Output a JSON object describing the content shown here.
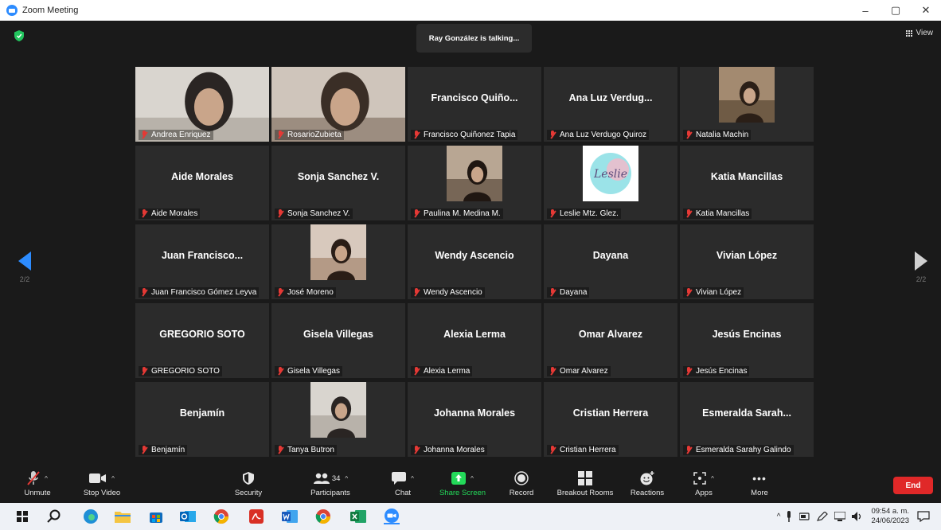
{
  "window": {
    "title": "Zoom Meeting",
    "minimize": "–",
    "maximize": "▢",
    "close": "✕"
  },
  "header": {
    "talking": "Ray González is talking...",
    "view_label": "View"
  },
  "pagination": {
    "left": "2/2",
    "right": "2/2"
  },
  "tiles": [
    {
      "label": "Andrea Enriquez",
      "video": "full"
    },
    {
      "label": "RosarioZubieta",
      "video": "full"
    },
    {
      "big": "Francisco  Quiño...",
      "label": "Francisco Quiñonez Tapia"
    },
    {
      "big": "Ana Luz Verdug...",
      "label": "Ana Luz Verdugo Quiroz"
    },
    {
      "label": "Natalia Machin",
      "video": "thumb"
    },
    {
      "big": "Aide Morales",
      "label": "Aide Morales"
    },
    {
      "big": "Sonja Sanchez V.",
      "label": "Sonja Sanchez V."
    },
    {
      "label": "Paulina M. Medina M.",
      "video": "thumb"
    },
    {
      "label": "Leslie Mtz. Glez.",
      "video": "logo",
      "logo_text": "Leslie"
    },
    {
      "big": "Katia Mancillas",
      "label": "Katia Mancillas"
    },
    {
      "big": "Juan  Francisco...",
      "label": "Juan Francisco Gómez Leyva"
    },
    {
      "label": "José Moreno",
      "video": "thumb"
    },
    {
      "big": "Wendy Ascencio",
      "label": "Wendy Ascencio"
    },
    {
      "big": "Dayana",
      "label": "Dayana"
    },
    {
      "big": "Vivian López",
      "label": "Vivian López"
    },
    {
      "big": "GREGORIO SOTO",
      "label": "GREGORIO SOTO"
    },
    {
      "big": "Gisela Villegas",
      "label": "Gisela Villegas"
    },
    {
      "big": "Alexia Lerma",
      "label": "Alexia Lerma"
    },
    {
      "big": "Omar Alvarez",
      "label": "Omar Alvarez"
    },
    {
      "big": "Jesús Encinas",
      "label": "Jesús Encinas"
    },
    {
      "big": "Benjamín",
      "label": "Benjamín"
    },
    {
      "label": "Tanya Butron",
      "video": "thumb"
    },
    {
      "big": "Johanna Morales",
      "label": "Johanna Morales"
    },
    {
      "big": "Cristian Herrera",
      "label": "Cristian Herrera"
    },
    {
      "big": "Esmeralda  Sarah...",
      "label": "Esmeralda Sarahy Galindo"
    }
  ],
  "controls": {
    "unmute": "Unmute",
    "stop_video": "Stop Video",
    "security": "Security",
    "participants": "Participants",
    "participants_count": "34",
    "chat": "Chat",
    "share_screen": "Share Screen",
    "record": "Record",
    "breakout": "Breakout Rooms",
    "reactions": "Reactions",
    "apps": "Apps",
    "more": "More",
    "end": "End"
  },
  "taskbar": {
    "time": "09:54 a. m.",
    "date": "24/06/2023"
  },
  "colors": {
    "zoom_blue": "#2D8CFF",
    "share_green": "#23D959",
    "end_red": "#E02828",
    "muted_red": "#E53935"
  }
}
